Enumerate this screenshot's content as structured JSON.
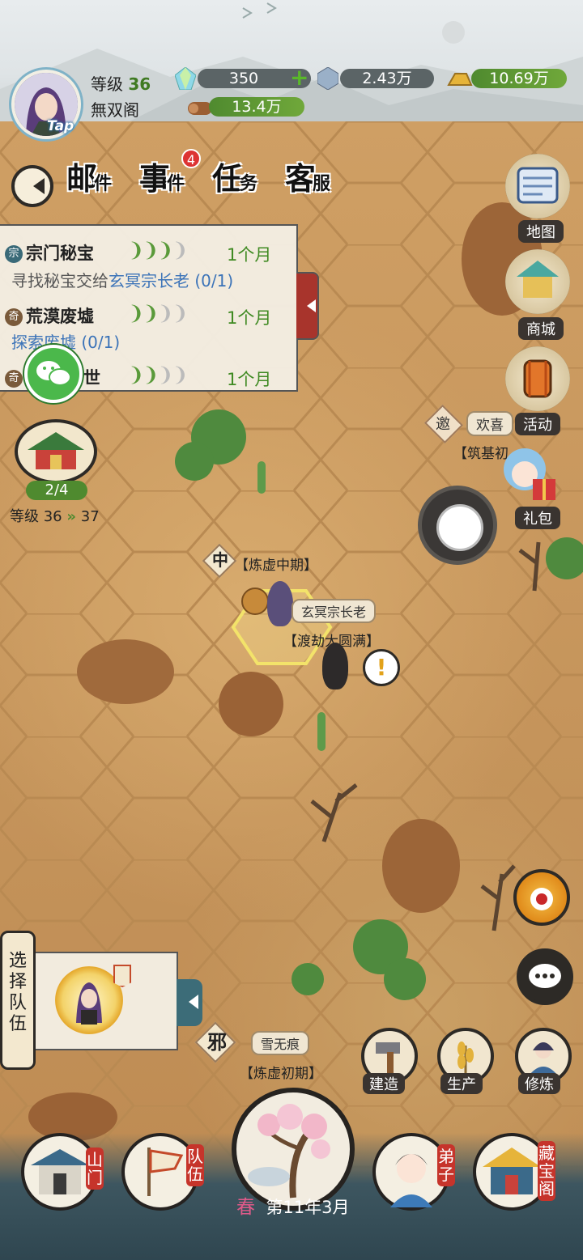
{
  "header": {
    "avatar_tag": "Tap",
    "level_label": "等级",
    "level_value": "36",
    "sect_name": "無双阁",
    "resources": {
      "spirit_stone": "350",
      "crystal": "2.43万",
      "gold": "10.69万",
      "wood": "13.4万"
    }
  },
  "top_nav": {
    "mail": "邮件",
    "event": "事件",
    "event_badge": "4",
    "task": "任务",
    "service": "客服"
  },
  "quests": [
    {
      "icon": "宗",
      "title": "宗门秘宝",
      "dots_filled": "3",
      "dots_empty": "1",
      "time": "1个月",
      "desc_pre": "寻找秘宝交给",
      "desc_target": "玄冥宗长老",
      "desc_progress": "(0/1)"
    },
    {
      "icon": "奇",
      "title": "荒漠废墟",
      "dots_filled": "2",
      "dots_empty": "2",
      "time": "1个月",
      "desc_pre": "",
      "desc_target": "探索废墟",
      "desc_progress": "(0/1)"
    },
    {
      "icon": "奇",
      "title": "出世",
      "dots_filled": "2",
      "dots_empty": "2",
      "time": "1个月",
      "desc_pre": "",
      "desc_target": "",
      "desc_progress": ""
    }
  ],
  "left_side": {
    "building_progress": "2/4",
    "upgrade_label": "等级 36",
    "upgrade_next": "37",
    "team_select": "选择队伍"
  },
  "right_side": {
    "map": "地图",
    "shop": "商城",
    "activity": "活动",
    "invite_tag": "邀",
    "welcome_text": "欢喜",
    "gift": "礼包",
    "npc_title_partial": "【筑基初"
  },
  "map_labels": {
    "realm_center": "中",
    "realm_center_text": "【炼虚中期】",
    "npc_name": "玄冥宗长老",
    "npc_realm": "【渡劫大圆满】",
    "quest_mark": "!",
    "realm_evil": "邪",
    "evil_name": "雪无痕",
    "evil_realm": "【炼虚初期】"
  },
  "actions": {
    "build": "建造",
    "produce": "生产",
    "cultivate": "修炼"
  },
  "bottom_nav": {
    "sect_gate": "山门",
    "team": "队伍",
    "season": "春",
    "date": "第11年3月",
    "disciple": "弟子",
    "treasury": "藏宝阁"
  },
  "colors": {
    "accent_green": "#4f8a2f",
    "badge_red": "#d33333",
    "quest_blue": "#3b73b8"
  }
}
